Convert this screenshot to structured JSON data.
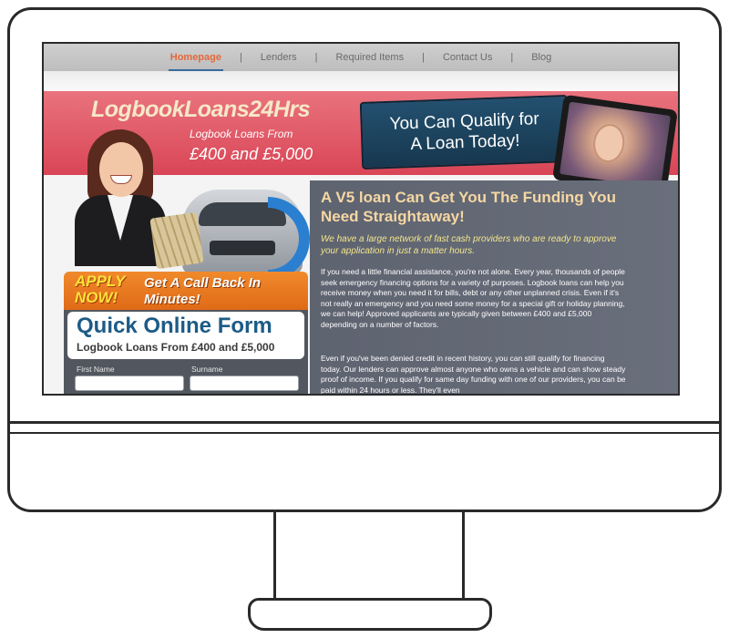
{
  "nav": {
    "items": [
      "Homepage",
      "Lenders",
      "Required Items",
      "Contact Us",
      "Blog"
    ],
    "active": "Homepage",
    "separator": "|"
  },
  "banner": {
    "logo": "LogbookLoans24Hrs",
    "tagline_line1": "Logbook Loans From",
    "tagline_line2": "£400 and £5,000",
    "qualify_line1": "You Can Qualify for",
    "qualify_line2": "A Loan Today!"
  },
  "apply": {
    "apply_now": "APPLY NOW!",
    "callback": "Get A Call Back In Minutes!"
  },
  "form": {
    "title": "Quick Online Form",
    "subtitle": "Logbook Loans From £400 and £5,000",
    "first_name_label": "First Name",
    "surname_label": "Surname",
    "first_name_value": "",
    "surname_value": ""
  },
  "content": {
    "headline": "A V5 loan Can Get You The Funding You Need Straightaway!",
    "subheadline": "We have a large network of fast cash providers who are ready to approve your application in just a matter hours.",
    "paragraph1": "If you need a little financial assistance, you're not alone. Every year, thousands of people seek emergency financing options for a variety of purposes. Logbook loans can help you receive money when you need it for bills, debt or any other unplanned crisis. Even if it's not really an emergency and you need some money for a special gift or holiday planning, we can help! Approved applicants are typically given between £400 and £5,000 depending on a number of factors.",
    "paragraph2": "Even if you've been denied credit in recent history, you can still qualify for financing today. Our lenders can approve almost anyone who owns a vehicle and can show steady proof of income. If you qualify for same day funding with one of our providers, you can be paid within 24 hours or less. They'll even"
  },
  "colors": {
    "nav_active": "#e4683a",
    "banner_red": "#d94556",
    "logo_cream": "#f6e8c8",
    "qualify_blue": "#17384f",
    "apply_orange": "#e06a17",
    "apply_yellow": "#ffe23a",
    "form_title_blue": "#1d5b86",
    "headline_gold": "#f5d7a2",
    "subhead_yellow": "#f3e68c"
  }
}
